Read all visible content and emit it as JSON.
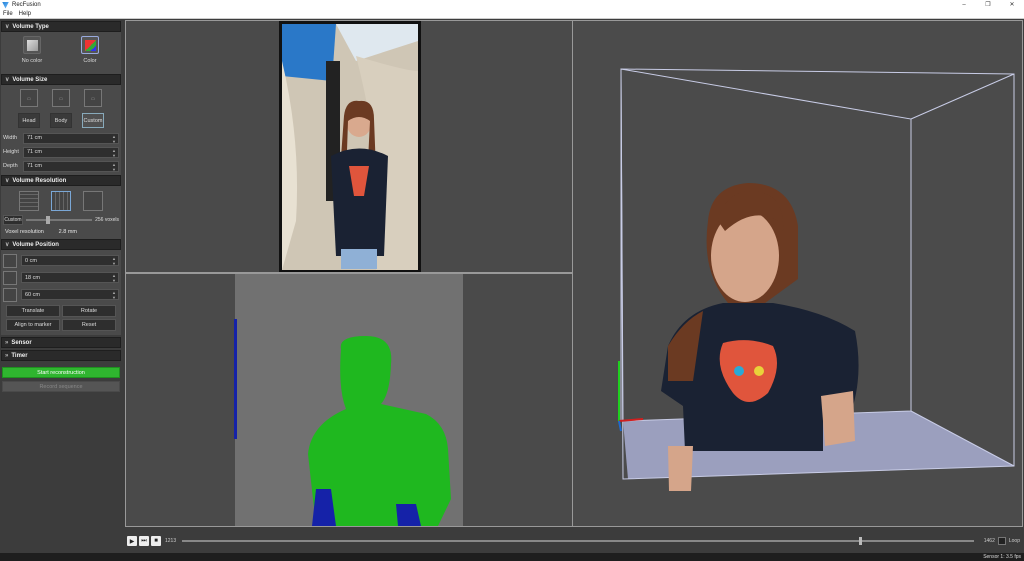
{
  "window": {
    "title": "RecFusion",
    "controls": [
      "minimize-icon",
      "restore-icon",
      "close-icon"
    ]
  },
  "menu": [
    "File",
    "Help"
  ],
  "sidebar": {
    "volume_type": {
      "header": "Volume Type",
      "options": [
        {
          "label": "No color",
          "icon": "gray-cube-icon"
        },
        {
          "label": "Color",
          "icon": "color-cube-icon"
        }
      ],
      "selected": "Color"
    },
    "volume_size": {
      "header": "Volume Size",
      "presets": [
        "Head",
        "Body",
        "Custom"
      ],
      "selected": "Custom",
      "width_label": "Width",
      "width": "71 cm",
      "height_label": "Height",
      "height": "71 cm",
      "depth_label": "Depth",
      "depth": "71 cm"
    },
    "volume_resolution": {
      "header": "Volume Resolution",
      "mode": "Custom",
      "voxels": "256 voxels",
      "voxel_label": "Voxel resolution",
      "voxel_value": "2.8 mm"
    },
    "volume_position": {
      "header": "Volume Position",
      "x": "0 cm",
      "y": "18 cm",
      "z": "60 cm",
      "buttons": [
        "Translate",
        "Rotate",
        "Align to marker",
        "Reset"
      ]
    },
    "sensor_header": "Sensor",
    "timer_header": "Timer",
    "start_label": "Start reconstruction",
    "record_label": "Record sequence"
  },
  "transport": {
    "start_frame": "1213",
    "end_frame": "1462",
    "playhead": 0.855,
    "loop_label": "Loop"
  },
  "status": "Sensor 1: 3.5 fps",
  "colors": {
    "accent_green": "#2fb52f",
    "panel": "#4a4a4a",
    "header": "#2a2a2a",
    "depth_person": "#1fb81f",
    "depth_floor": "#1522a8"
  }
}
